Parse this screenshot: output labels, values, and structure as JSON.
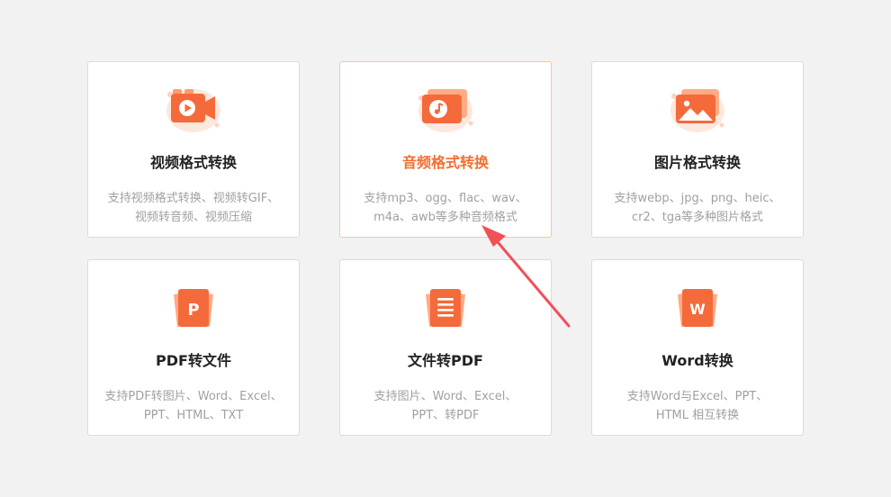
{
  "cards": [
    {
      "title": "视频格式转换",
      "desc_line1": "支持视频格式转换、视频转GIF、",
      "desc_line2": "视频转音频、视频压缩",
      "icon": "video-file-icon"
    },
    {
      "title": "音频格式转换",
      "desc_line1": "支持mp3、ogg、flac、wav、",
      "desc_line2": "m4a、awb等多种音频格式",
      "icon": "audio-file-icon",
      "active": true
    },
    {
      "title": "图片格式转换",
      "desc_line1": "支持webp、jpg、png、heic、",
      "desc_line2": "cr2、tga等多种图片格式",
      "icon": "image-file-icon"
    },
    {
      "title": "PDF转文件",
      "desc_line1": "支持PDF转图片、Word、Excel、",
      "desc_line2": "PPT、HTML、TXT",
      "icon": "pdf-file-icon",
      "glyph": "P"
    },
    {
      "title": "文件转PDF",
      "desc_line1": "支持图片、Word、Excel、",
      "desc_line2": "PPT、转PDF",
      "icon": "document-file-icon"
    },
    {
      "title": "Word转换",
      "desc_line1": "支持Word与Excel、PPT、",
      "desc_line2": "HTML 相互转换",
      "icon": "word-file-icon",
      "glyph": "W"
    }
  ],
  "colors": {
    "accent": "#f46f2f",
    "icon_light": "#ffab85",
    "icon_dark": "#f2552a",
    "annotation_arrow": "#f0505a"
  }
}
